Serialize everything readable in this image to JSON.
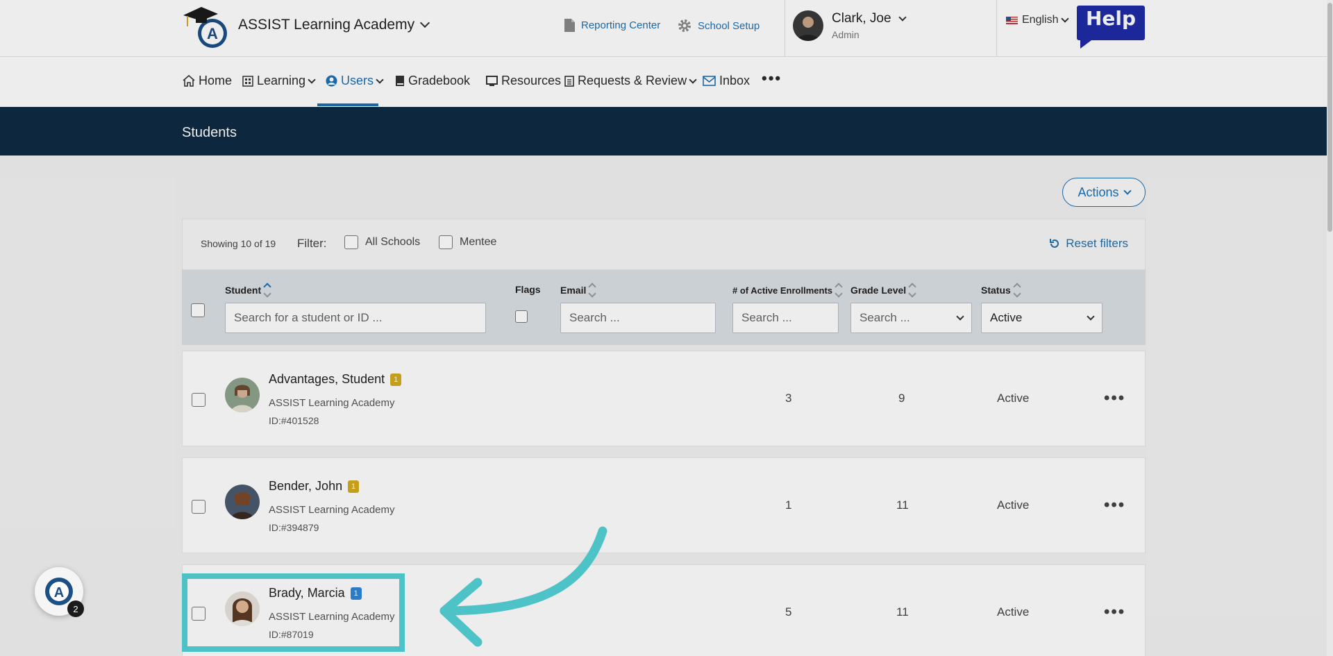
{
  "header": {
    "school_name": "ASSIST Learning Academy",
    "reporting_center": "Reporting Center",
    "school_setup": "School Setup",
    "user_name": "Clark, Joe",
    "user_role": "Admin",
    "language": "English",
    "help_label": "Help"
  },
  "nav": {
    "items": [
      {
        "label": "Home",
        "icon": "home-icon"
      },
      {
        "label": "Learning",
        "icon": "grid-icon"
      },
      {
        "label": "Users",
        "icon": "user-circle-icon",
        "active": true
      },
      {
        "label": "Gradebook",
        "icon": "book-icon"
      },
      {
        "label": "Resources",
        "icon": "monitor-icon"
      },
      {
        "label": "Requests & Review",
        "icon": "clipboard-icon"
      },
      {
        "label": "Inbox",
        "icon": "mail-icon"
      }
    ],
    "more": "•••"
  },
  "page": {
    "title": "Students",
    "actions_label": "Actions"
  },
  "filters": {
    "showing": "Showing 10 of 19",
    "filter_label": "Filter:",
    "all_schools": "All Schools",
    "mentee": "Mentee",
    "reset": "Reset filters"
  },
  "table": {
    "headers": {
      "student": "Student",
      "flags": "Flags",
      "email": "Email",
      "enrollments": "# of Active Enrollments",
      "grade": "Grade Level",
      "status": "Status"
    },
    "placeholders": {
      "student": "Search for a student or ID ...",
      "email": "Search ...",
      "enrollments": "Search ...",
      "grade": "Search ..."
    },
    "status_selected": "Active",
    "rows": [
      {
        "name": "Advantages, Student",
        "flag": "1",
        "flag_color": "#d4ac1e",
        "school": "ASSIST Learning Academy",
        "id": "ID:#401528",
        "enrollments": "3",
        "grade": "9",
        "status": "Active"
      },
      {
        "name": "Bender, John",
        "flag": "1",
        "flag_color": "#d4ac1e",
        "school": "ASSIST Learning Academy",
        "id": "ID:#394879",
        "enrollments": "1",
        "grade": "11",
        "status": "Active"
      },
      {
        "name": "Brady, Marcia",
        "flag": "1",
        "flag_color": "#2f86d6",
        "school": "ASSIST Learning Academy",
        "id": "ID:#87019",
        "enrollments": "5",
        "grade": "11",
        "status": "Active"
      }
    ]
  },
  "chat": {
    "count": "2"
  },
  "colors": {
    "accent": "#1f6fb2",
    "band": "#0e2a44",
    "highlight": "#4dc3c8"
  }
}
